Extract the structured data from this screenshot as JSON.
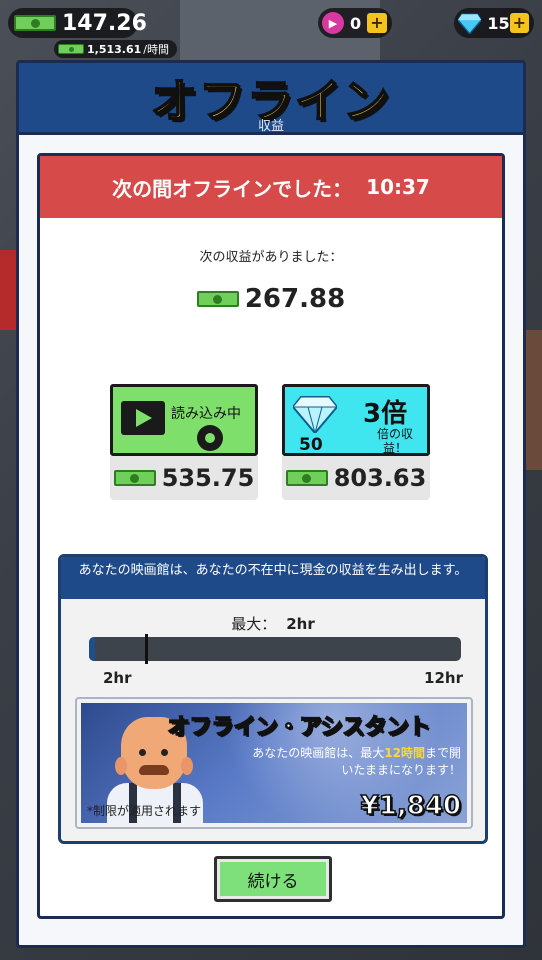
{
  "hud": {
    "cash": "147.26",
    "rate_amount": "1,513.61",
    "rate_unit": "/時間",
    "tickets": "0",
    "gems": "15",
    "plus": "+"
  },
  "modal": {
    "title": "オフライン",
    "subtitle": "収益",
    "offline_label": "次の間オフラインでした：",
    "offline_time": "10:37",
    "earned_label": "次の収益がありました：",
    "earned_amount": "267.88"
  },
  "options": {
    "ad": {
      "label": "読み込み中",
      "value": "535.75"
    },
    "gems": {
      "cost": "50",
      "multiplier": "3倍",
      "multiplier_sub": "倍の収益！",
      "value": "803.63"
    }
  },
  "info": {
    "header": "あなたの映画館は、あなたの不在中に現金の収益を生み出します。",
    "max_label": "最大：",
    "max_value": "2hr",
    "slider_min": "2hr",
    "slider_max": "12hr",
    "slider_level": 0.0,
    "assistant": {
      "title": "オフライン・アシスタント",
      "desc_prefix": "あなたの映画館は、最大",
      "desc_highlight": "12時間",
      "desc_suffix": "まで開いたままになります！",
      "note": "*制限が適用されます",
      "price": "¥1,840"
    }
  },
  "buttons": {
    "continue": "続ける"
  },
  "colors": {
    "header_blue": "#1f4a8a",
    "offline_red": "#d64a4a",
    "title_yellow": "#ffd836",
    "ad_green": "#7ee06b",
    "gem_cyan": "#3fe6f0"
  }
}
